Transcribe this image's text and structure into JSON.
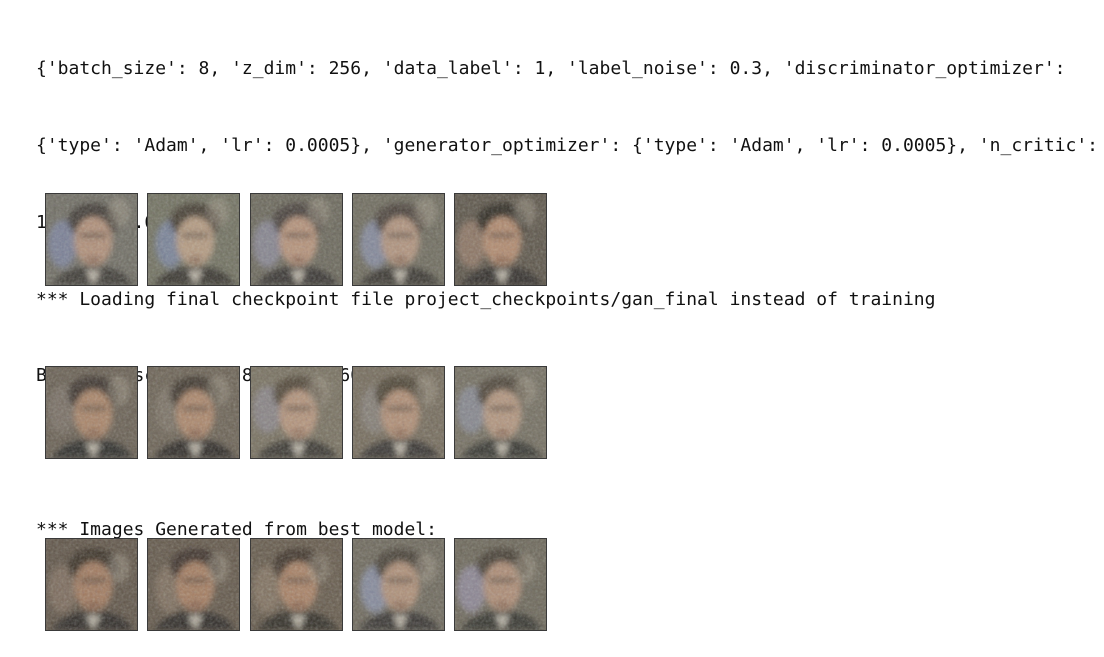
{
  "output": {
    "lines": [
      "{'batch_size': 8, 'z_dim': 256, 'data_label': 1, 'label_noise': 0.3, 'discriminator_optimizer':",
      "{'type': 'Adam', 'lr': 0.0005}, 'generator_optimizer': {'type': 'Adam', 'lr': 0.0005}, 'n_critic':",
      "1, 'c': 0.0}",
      "*** Loading final checkpoint file project_checkpoints/gan_final instead of training",
      "Best fid score is: 808.4785160203573",
      "",
      "*** Images Generated from best model:"
    ]
  },
  "generated_images": {
    "rows": 3,
    "columns": 5,
    "rows_data": [
      [
        {
          "bg": "#6f6d63",
          "face": "#b08f78",
          "hair": "#3f3a34",
          "suit": "#3c3a35",
          "tint": "#7c86a6"
        },
        {
          "bg": "#70705f",
          "face": "#b49a80",
          "hair": "#453d33",
          "suit": "#37352f",
          "tint": "#7b88aa"
        },
        {
          "bg": "#6a675a",
          "face": "#b59279",
          "hair": "#46403a",
          "suit": "#383630",
          "tint": "#8f8ea0"
        },
        {
          "bg": "#6e6b5d",
          "face": "#b0937d",
          "hair": "#4b433a",
          "suit": "#3b3933",
          "tint": "#8a92ad"
        },
        {
          "bg": "#5c5549",
          "face": "#b18a6e",
          "hair": "#2f2a24",
          "suit": "#302e29",
          "tint": "#9b7d6b"
        }
      ],
      [
        {
          "bg": "#685f52",
          "face": "#a98468",
          "hair": "#3d352d",
          "suit": "#2f2d29",
          "tint": "#7c7468"
        },
        {
          "bg": "#6b6254",
          "face": "#ab866b",
          "hair": "#3f372e",
          "suit": "#2e2c28",
          "tint": "#80776a"
        },
        {
          "bg": "#77705f",
          "face": "#b3937a",
          "hair": "#514638",
          "suit": "#3a3832",
          "tint": "#8d8a92"
        },
        {
          "bg": "#746b5b",
          "face": "#b08e74",
          "hair": "#4e4436",
          "suit": "#393630",
          "tint": "#8a847f"
        },
        {
          "bg": "#736e60",
          "face": "#b2957e",
          "hair": "#4f463a",
          "suit": "#393731",
          "tint": "#8b8f9c"
        }
      ],
      [
        {
          "bg": "#5f5447",
          "face": "#a17a5e",
          "hair": "#3a3128",
          "suit": "#2d2a25",
          "tint": "#847262"
        },
        {
          "bg": "#625749",
          "face": "#a47d61",
          "hair": "#3c3329",
          "suit": "#2e2b26",
          "tint": "#877564"
        },
        {
          "bg": "#655a4b",
          "face": "#a88165",
          "hair": "#40362b",
          "suit": "#302d27",
          "tint": "#8a7866"
        },
        {
          "bg": "#6d685b",
          "face": "#ae8f77",
          "hair": "#4a4237",
          "suit": "#373530",
          "tint": "#8c94b0"
        },
        {
          "bg": "#6b6658",
          "face": "#ad8c74",
          "hair": "#473f34",
          "suit": "#36342f",
          "tint": "#9690a6"
        }
      ]
    ]
  }
}
